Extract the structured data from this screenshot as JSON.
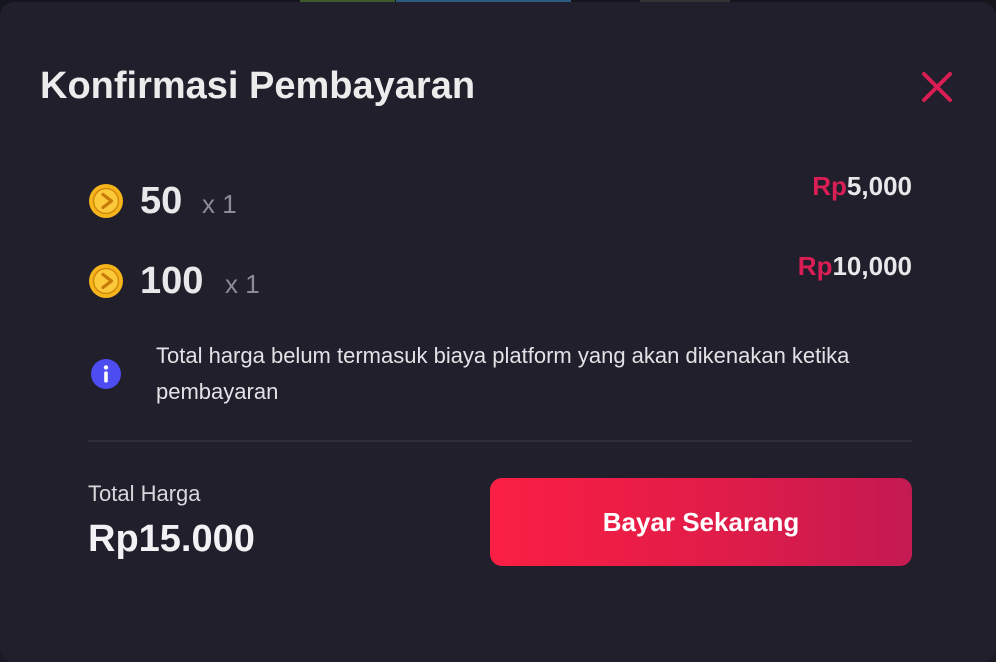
{
  "modal": {
    "title": "Konfirmasi Pembayaran",
    "close_icon": "close-icon"
  },
  "items": [
    {
      "icon": "coin-icon",
      "quantity": "50",
      "multiplier": "x 1",
      "currency": "Rp",
      "price": "5,000"
    },
    {
      "icon": "coin-icon",
      "quantity": "100",
      "multiplier": "x 1",
      "currency": "Rp",
      "price": "10,000"
    }
  ],
  "info": {
    "icon": "info-icon",
    "text": "Total harga belum termasuk biaya platform yang akan dikenakan ketika pembayaran"
  },
  "total": {
    "label": "Total Harga",
    "value": "Rp15.000"
  },
  "pay_button": {
    "label": "Bayar Sekarang"
  },
  "colors": {
    "accent": "#d81e54",
    "button_start": "#fb1f44",
    "button_end": "#c41a52",
    "coin": "#f7b51c",
    "info": "#4d4cf0",
    "background": "#201f2b"
  }
}
